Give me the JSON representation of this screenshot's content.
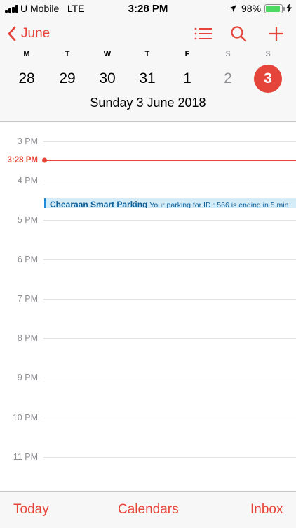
{
  "status_bar": {
    "carrier": "U Mobile",
    "network": "LTE",
    "time": "3:28 PM",
    "battery": "98%",
    "battery_level": 0.98,
    "icons": [
      "signal-icon",
      "location-arrow-icon",
      "battery-icon",
      "charging-bolt-icon"
    ]
  },
  "header": {
    "back_label": "June",
    "icons": [
      "list-icon",
      "search-icon",
      "add-icon"
    ],
    "week": [
      {
        "weekday": "M",
        "day": "28"
      },
      {
        "weekday": "T",
        "day": "29"
      },
      {
        "weekday": "W",
        "day": "30"
      },
      {
        "weekday": "T",
        "day": "31"
      },
      {
        "weekday": "F",
        "day": "1"
      },
      {
        "weekday": "S",
        "day": "2"
      },
      {
        "weekday": "S",
        "day": "3"
      }
    ],
    "selected_index": 6,
    "day_title": "Sunday  3 June 2018"
  },
  "timeline": {
    "hours": [
      "3 PM",
      "4 PM",
      "5 PM",
      "6 PM",
      "7 PM",
      "8 PM",
      "9 PM",
      "10 PM",
      "11 PM"
    ],
    "current_time": "3:28 PM",
    "event": {
      "title": "Chearaan Smart Parking",
      "description": "Your parking for ID : 566 is ending in 5 min"
    }
  },
  "tabbar": {
    "today": "Today",
    "calendars": "Calendars",
    "inbox": "Inbox"
  },
  "colors": {
    "accent": "#e5443a",
    "event_bg": "#d5ecf9",
    "event_text": "#0f5e94",
    "battery": "#4cd964"
  }
}
